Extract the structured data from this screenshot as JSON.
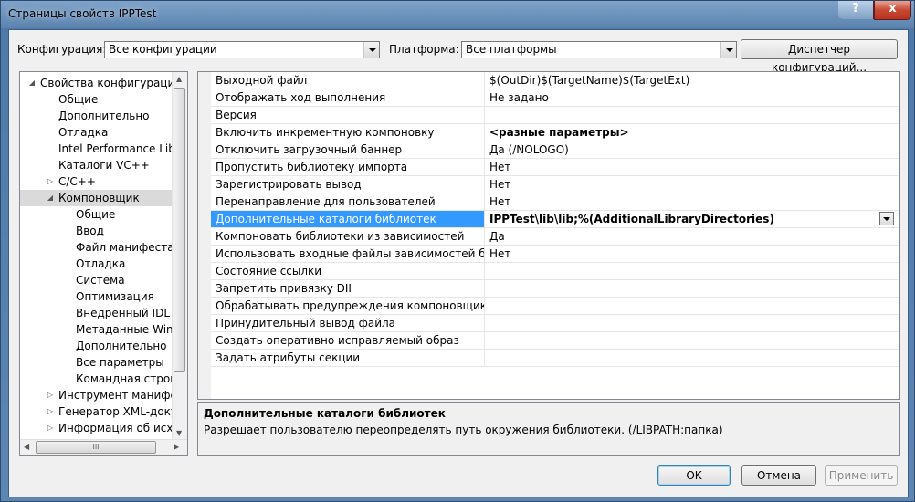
{
  "window": {
    "title": "Страницы свойств IPPTest",
    "help_label": "?",
    "close_label": "x"
  },
  "toolbar": {
    "config_label": "Конфигурация:",
    "config_value": "Все конфигурации",
    "platform_label": "Платформа:",
    "platform_value": "Все платформы",
    "config_manager_label": "Диспетчер конфигураций..."
  },
  "tree": {
    "items": [
      {
        "label": "Свойства конфигурации",
        "level": 0,
        "expander": "◢"
      },
      {
        "label": "Общие",
        "level": 1
      },
      {
        "label": "Дополнительно",
        "level": 1
      },
      {
        "label": "Отладка",
        "level": 1
      },
      {
        "label": "Intel Performance Libra",
        "level": 1
      },
      {
        "label": "Каталоги VC++",
        "level": 1
      },
      {
        "label": "C/C++",
        "level": 1,
        "expander": "▷"
      },
      {
        "label": "Компоновщик",
        "level": 1,
        "expander": "◢",
        "selected": true
      },
      {
        "label": "Общие",
        "level": 2
      },
      {
        "label": "Ввод",
        "level": 2
      },
      {
        "label": "Файл манифеста",
        "level": 2
      },
      {
        "label": "Отладка",
        "level": 2
      },
      {
        "label": "Система",
        "level": 2
      },
      {
        "label": "Оптимизация",
        "level": 2
      },
      {
        "label": "Внедренный IDL",
        "level": 2
      },
      {
        "label": "Метаданные Windo",
        "level": 2
      },
      {
        "label": "Дополнительно",
        "level": 2
      },
      {
        "label": "Все параметры",
        "level": 2
      },
      {
        "label": "Командная строка",
        "level": 2
      },
      {
        "label": "Инструмент манифест",
        "level": 1,
        "expander": "▷"
      },
      {
        "label": "Генератор XML-докум",
        "level": 1,
        "expander": "▷"
      },
      {
        "label": "Информация об исход",
        "level": 1,
        "expander": "▷"
      }
    ],
    "hscroll_grip": "III"
  },
  "grid": {
    "rows": [
      {
        "name": "Выходной файл",
        "value": "$(OutDir)$(TargetName)$(TargetExt)"
      },
      {
        "name": "Отображать ход выполнения",
        "value": "Не задано"
      },
      {
        "name": "Версия",
        "value": ""
      },
      {
        "name": "Включить инкрементную компоновку",
        "value": "<разные параметры>",
        "bold": true
      },
      {
        "name": "Отключить загрузочный баннер",
        "value": "Да (/NOLOGO)"
      },
      {
        "name": "Пропустить библиотеку импорта",
        "value": "Нет"
      },
      {
        "name": "Зарегистрировать вывод",
        "value": "Нет"
      },
      {
        "name": "Перенаправление для пользователей",
        "value": "Нет"
      },
      {
        "name": "Дополнительные каталоги библиотек",
        "value": "IPPTest\\lib\\lib;%(AdditionalLibraryDirectories)",
        "bold": true,
        "selected": true
      },
      {
        "name": "Компоновать библиотеки из зависимостей",
        "value": "Да"
      },
      {
        "name": "Использовать входные файлы зависимостей библиот",
        "value": "Нет"
      },
      {
        "name": "Состояние ссылки",
        "value": ""
      },
      {
        "name": "Запретить привязку DII",
        "value": ""
      },
      {
        "name": "Обрабатывать предупреждения компоновщика как о",
        "value": ""
      },
      {
        "name": "Принудительный вывод файла",
        "value": ""
      },
      {
        "name": "Создать оперативно исправляемый образ",
        "value": ""
      },
      {
        "name": "Задать атрибуты секции",
        "value": ""
      }
    ]
  },
  "description": {
    "title": "Дополнительные каталоги библиотек",
    "text": "Разрешает пользователю переопределять путь окружения библиотеки. (/LIBPATH:папка)"
  },
  "buttons": {
    "ok": "OK",
    "cancel": "Отмена",
    "apply": "Применить"
  }
}
